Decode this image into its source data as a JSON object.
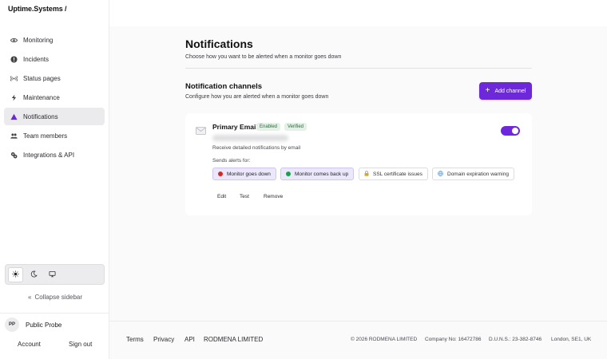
{
  "brand": "Uptime.Systems /",
  "sidebar": {
    "items": [
      {
        "label": "Monitoring",
        "icon": "eye-icon"
      },
      {
        "label": "Incidents",
        "icon": "alert-circle-icon"
      },
      {
        "label": "Status pages",
        "icon": "broadcast-icon"
      },
      {
        "label": "Maintenance",
        "icon": "bolt-icon"
      },
      {
        "label": "Notifications",
        "icon": "warning-triangle-icon",
        "active": true
      },
      {
        "label": "Team members",
        "icon": "users-icon"
      },
      {
        "label": "Integrations & API",
        "icon": "cogs-icon"
      }
    ],
    "theme_options": [
      "sun-icon",
      "moon-icon",
      "monitor-icon"
    ],
    "theme_selected": "sun-icon",
    "collapse_label": "Collapse sidebar",
    "user": {
      "initials": "PP",
      "name": "Public Probe"
    },
    "account_label": "Account",
    "signout_label": "Sign out"
  },
  "page": {
    "title": "Notifications",
    "subtitle": "Choose how you want to be alerted when a monitor goes down"
  },
  "channels": {
    "title": "Notification channels",
    "subtitle": "Configure how you are alerted when a monitor goes down",
    "add_label": "Add channel",
    "card": {
      "name": "Primary Email",
      "badges": [
        "Enabled",
        "Verified"
      ],
      "description": "Receive detailed notifications by email",
      "sends_label": "Sends alerts for:",
      "enabled": true,
      "alerts": [
        {
          "label": "Monitor goes down",
          "selected": true,
          "color": "#dc2626"
        },
        {
          "label": "Monitor comes back up",
          "selected": true,
          "color": "#16a34a"
        },
        {
          "label": "SSL certificate issues",
          "selected": false,
          "icon": "lock-icon"
        },
        {
          "label": "Domain expiration warning",
          "selected": false,
          "icon": "globe-icon"
        }
      ],
      "actions": [
        "Edit",
        "Test",
        "Remove"
      ]
    }
  },
  "footer": {
    "links": [
      "Terms",
      "Privacy",
      "API",
      "RODMENA LIMITED"
    ],
    "copyright": "© 2026 RODMENA LIMITED",
    "company_no": "Company No: 16472786",
    "duns": "D.U.N.S.: 23-382-8746",
    "location": "London, SE1, UK"
  },
  "colors": {
    "accent": "#6d28d9",
    "down": "#dc2626",
    "up": "#16a34a"
  }
}
